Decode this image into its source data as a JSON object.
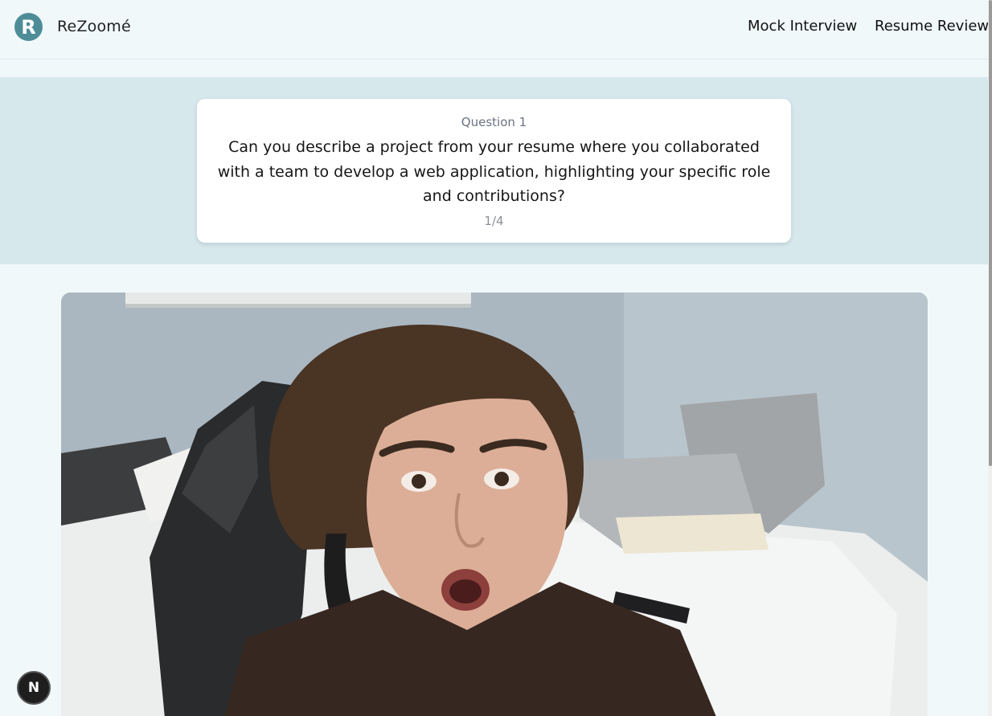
{
  "header": {
    "logo_letter": "R",
    "brand": "ReZoomé",
    "nav": [
      {
        "label": "Mock Interview"
      },
      {
        "label": "Resume Review"
      }
    ]
  },
  "question": {
    "label": "Question 1",
    "text": "Can you describe a project from your resume where you collaborated with a team to develop a web application, highlighting your specific role and contributions?",
    "progress": "1/4"
  },
  "dev_badge": {
    "letter": "N"
  },
  "icons": {
    "logo": "r-logo-icon",
    "dev_badge": "nextjs-icon"
  }
}
